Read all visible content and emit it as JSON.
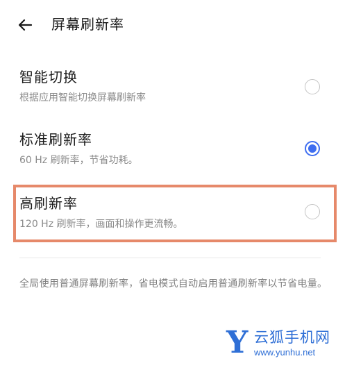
{
  "header": {
    "title": "屏幕刷新率",
    "back_icon": "arrow-left-icon"
  },
  "options": [
    {
      "title": "智能切换",
      "subtitle": "根据应用智能切换屏幕刷新率",
      "selected": false
    },
    {
      "title": "标准刷新率",
      "subtitle": "60 Hz 刷新率，节省功耗。",
      "selected": true
    },
    {
      "title": "高刷新率",
      "subtitle": "120 Hz 刷新率，画面和操作更流畅。",
      "selected": false
    }
  ],
  "footnote": "全局使用普通屏幕刷新率，省电模式自动启用普通刷新率以节省电量。",
  "watermark": {
    "letter": "Y",
    "name": "云狐手机网",
    "url": "www.yunhu.net"
  },
  "colors": {
    "accent": "#3f6ef0",
    "highlight": "#e6896a",
    "watermark": "#2f6fd6"
  }
}
